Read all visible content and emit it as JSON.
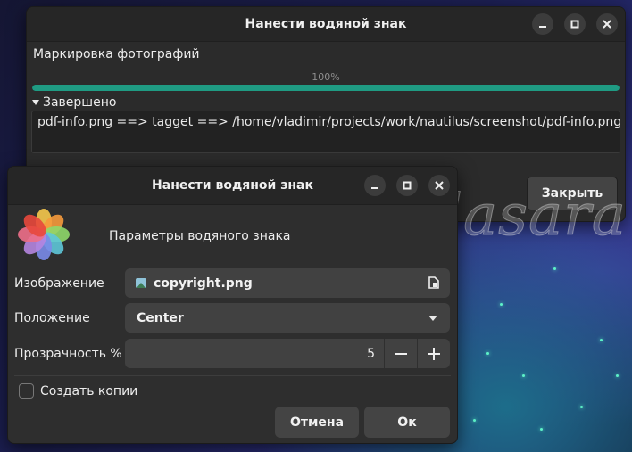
{
  "progress_window": {
    "title": "Нанести водяной знак",
    "task_label": "Маркировка фотографий",
    "progress_text": "100%",
    "progress_value": 1.0,
    "expander_label": "Завершено",
    "log_text": "pdf-info.png ==> tagget ==> /home/vladimir/projects/work/nautilus/screenshot/pdf-info.png",
    "close_button": "Закрыть"
  },
  "dialog": {
    "title": "Нанести водяной знак",
    "heading": "Параметры водяного знака",
    "image_label": "Изображение",
    "image_value": "copyright.png",
    "position_label": "Положение",
    "position_value": "Center",
    "opacity_label": "Прозрачность %",
    "opacity_value": "5",
    "copies_label": "Создать копии",
    "copies_checked": false,
    "cancel_button": "Отмена",
    "ok_button": "Ок"
  },
  "watermark_text": "Copyright © Vlasara",
  "colors": {
    "accent": "#1f9b83",
    "window_bg": "#2e2e2e",
    "field_bg": "#414141"
  },
  "icons": [
    "minimize-icon",
    "maximize-icon",
    "close-icon",
    "image-file-icon",
    "file-chooser-icon",
    "dropdown-arrow-icon",
    "minus-icon",
    "plus-icon",
    "app-logo-icon"
  ]
}
